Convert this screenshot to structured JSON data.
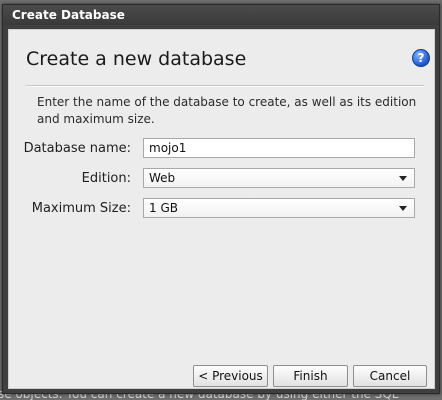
{
  "dialog": {
    "title": "Create Database",
    "heading": "Create a new database",
    "description": "Enter the name of the database to create, as well as its edition and maximum size.",
    "fields": {
      "name_label": "Database name:",
      "name_value": "mojo1",
      "edition_label": "Edition:",
      "edition_value": "Web",
      "size_label": "Maximum Size:",
      "size_value": "1 GB"
    },
    "buttons": {
      "previous": "< Previous",
      "finish": "Finish",
      "cancel": "Cancel"
    },
    "help_icon_glyph": "?"
  },
  "background": {
    "bottom_text": "se objects.  You can create a new database by using either the SQL"
  },
  "icons": {
    "help": "help-icon",
    "dropdown": "chevron-down-icon"
  },
  "colors": {
    "title_bar": "#3f3f3f",
    "client_bg": "#ececec",
    "help_blue": "#1d57c9"
  }
}
